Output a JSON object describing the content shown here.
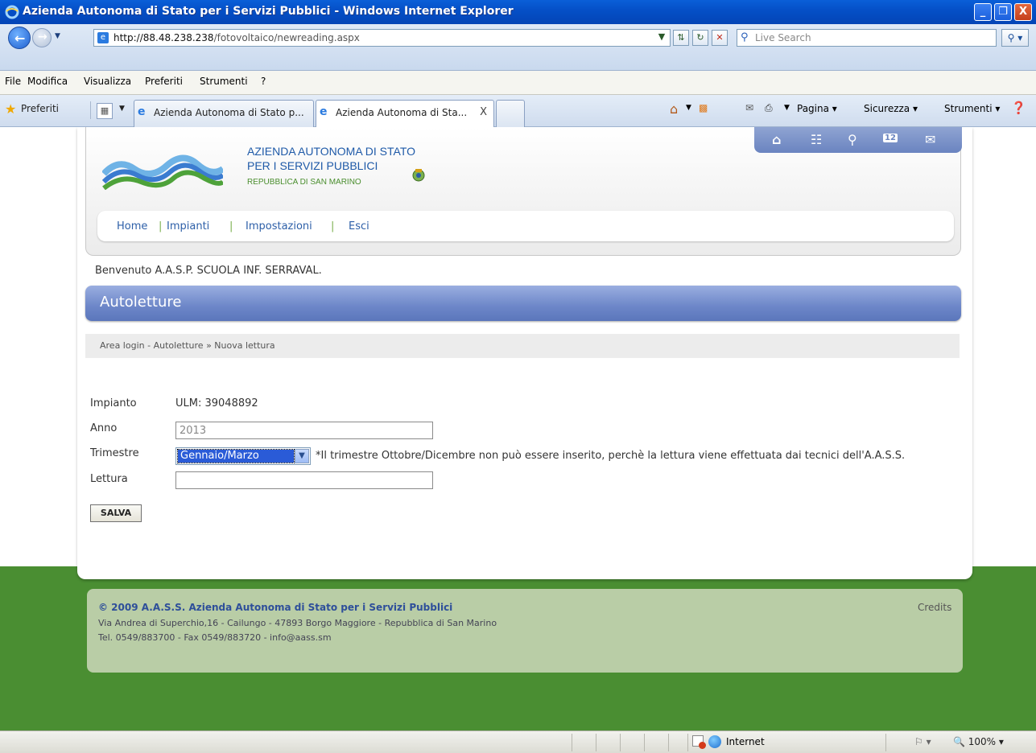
{
  "window": {
    "title": "Azienda Autonoma di Stato per i Servizi Pubblici - Windows Internet Explorer",
    "minimize_glyph": "_",
    "maximize_glyph": "❐",
    "close_glyph": "X"
  },
  "addressbar": {
    "url_host": "http://88.48.238.238",
    "url_path": "/fotovoltaico/newreading.aspx",
    "search_placeholder": "Live Search"
  },
  "menu": {
    "items": [
      "File",
      "Modifica",
      "Visualizza",
      "Preferiti",
      "Strumenti",
      "?"
    ]
  },
  "favorites": {
    "label": "Preferiti",
    "tabs": [
      {
        "label": "Azienda Autonoma di Stato p...",
        "active": false
      },
      {
        "label": "Azienda Autonoma di Sta...",
        "active": true,
        "close": "X"
      }
    ],
    "tools": {
      "page": "Pagina ▾",
      "security": "Sicurezza ▾",
      "tools": "Strumenti ▾"
    }
  },
  "site": {
    "org_line1": "AZIENDA AUTONOMA DI STATO",
    "org_line2": "PER I SERVIZI PUBBLICI",
    "org_line3": "REPUBBLICA DI SAN MARINO",
    "calendar_day": "12",
    "nav": [
      "Home",
      "Impianti",
      "Impostazioni",
      "Esci"
    ],
    "pipe": "|",
    "welcome": "Benvenuto A.A.S.P. SCUOLA INF. SERRAVAL.",
    "section_title": "Autoletture",
    "breadcrumb": "Area login - Autoletture » Nuova lettura"
  },
  "form": {
    "impianto_label": "Impianto",
    "impianto_value": "ULM: 39048892",
    "anno_label": "Anno",
    "anno_value": "2013",
    "trimestre_label": "Trimestre",
    "trimestre_value": "Gennaio/Marzo",
    "trimestre_note": "*Il trimestre Ottobre/Dicembre non può essere inserito, perchè la lettura viene effettuata dai tecnici dell'A.A.S.S.",
    "lettura_label": "Lettura",
    "lettura_value": "",
    "save_label": "SALVA"
  },
  "footer": {
    "title": "© 2009 A.A.S.S. Azienda Autonoma di Stato per i Servizi Pubblici",
    "address": "Via Andrea di Superchio,16 - Cailungo - 47893 Borgo Maggiore - Repubblica di San Marino",
    "contacts": "Tel. 0549/883700 - Fax 0549/883720 - info@aass.sm",
    "credits": "Credits"
  },
  "status": {
    "zone": "Internet",
    "zoom": "100%"
  },
  "colors": {
    "title_blue": "#0550c8",
    "section_blue": "#6c86c8",
    "green": "#4a8e32",
    "footer_green": "#b9cda6",
    "link_blue": "#2d5fa8"
  }
}
